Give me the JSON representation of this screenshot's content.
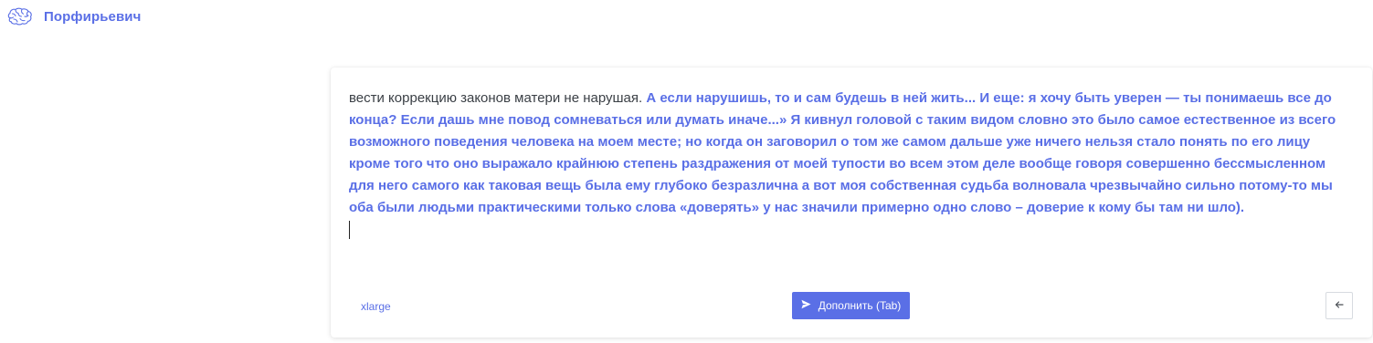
{
  "app": {
    "title": "Порфирьевич",
    "logo_icon": "brain-icon"
  },
  "editor": {
    "user_text": "вести коррекцию законов матери не нарушая. ",
    "generated_text": "А если нарушишь, то и сам будешь в ней жить... И еще: я хочу быть уверен — ты понимаешь все до конца? Если дашь мне повод сомневаться или думать иначе...» Я кивнул головой с таким видом словно это было самое естественное из всего возможного поведения человека на моем месте; но когда он заговорил о том же самом дальше уже ничего нельзя стало понять по его лицу кроме того что оно выражало крайнюю степень раздражения от моей тупости во всем этом деле вообще говоря совершенно бессмысленном для него самого как таковая вещь была ему глубоко безразлична а вот моя собственная судьба волновала чрезвычайно сильно потому-то мы оба были людьми практическими только слова «доверять» у нас значили примерно одно слово – доверие к кому бы там ни шло)."
  },
  "footer": {
    "model_label": "xlarge",
    "complete_button_label": "Дополнить (Tab)",
    "complete_icon": "send-icon",
    "back_icon": "arrow-left-icon"
  },
  "colors": {
    "accent": "#5a6fe6",
    "text": "#3a3f45",
    "background": "#ffffff"
  }
}
